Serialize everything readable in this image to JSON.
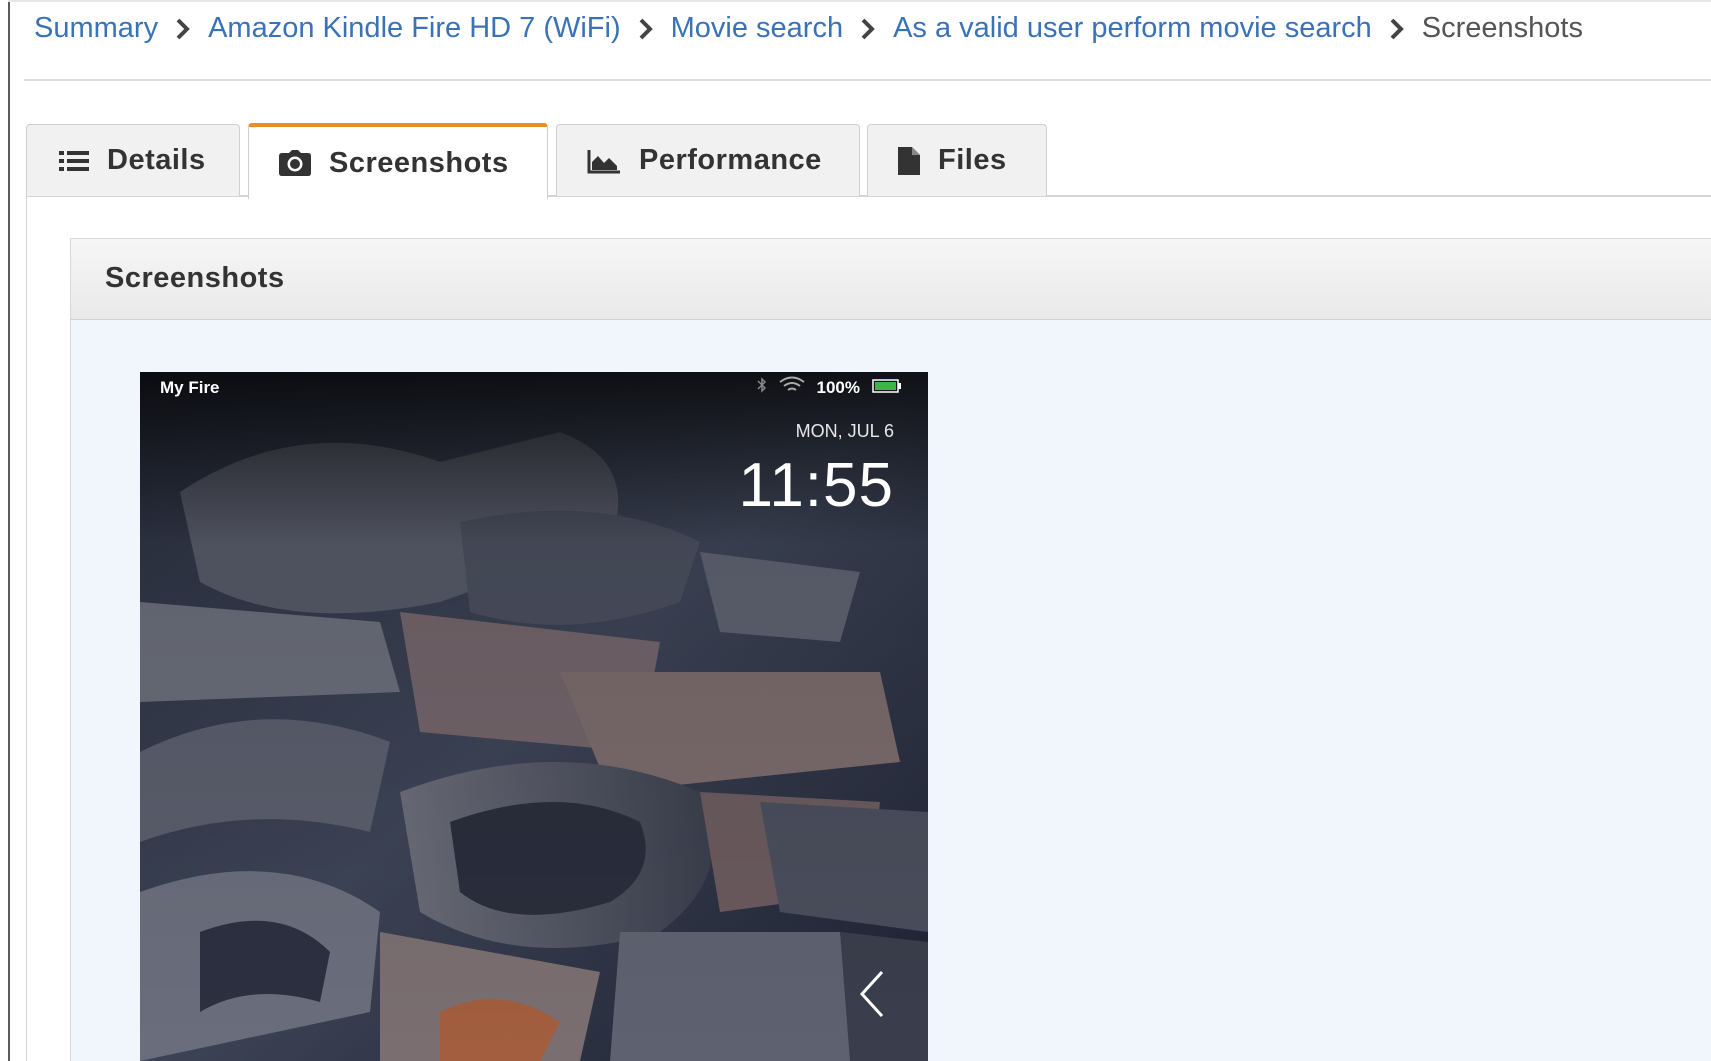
{
  "breadcrumb": {
    "items": [
      {
        "label": "Summary"
      },
      {
        "label": "Amazon Kindle Fire HD 7 (WiFi)"
      },
      {
        "label": "Movie search"
      },
      {
        "label": "As a valid user perform movie search"
      }
    ],
    "current": "Screenshots"
  },
  "tabs": [
    {
      "label": "Details",
      "icon": "list-icon"
    },
    {
      "label": "Screenshots",
      "icon": "camera-icon",
      "active": true
    },
    {
      "label": "Performance",
      "icon": "area-chart-icon"
    },
    {
      "label": "Files",
      "icon": "file-icon"
    }
  ],
  "panel": {
    "title": "Screenshots"
  },
  "device_screenshot": {
    "status_left": "My Fire",
    "battery": "100%",
    "date": "MON, JUL 6",
    "time": "11:55"
  },
  "colors": {
    "link": "#3a72b8",
    "active_tab_accent": "#f08a24",
    "panel_background": "#f1f6fc"
  }
}
